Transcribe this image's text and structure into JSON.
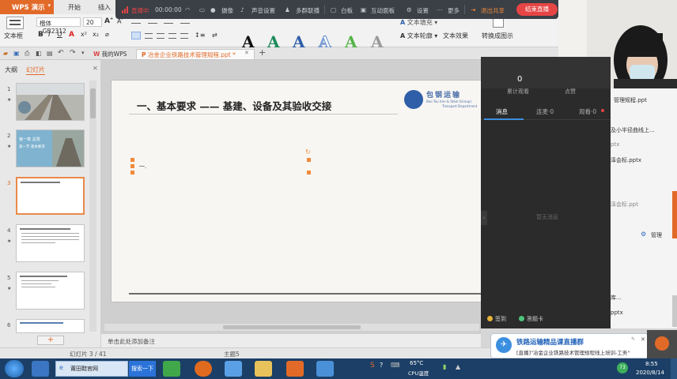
{
  "app": {
    "name": "WPS 演示",
    "menu": [
      "开始",
      "插入"
    ]
  },
  "ribbon": {
    "textbox_label": "文本框",
    "font_name": "楷体_GB2312",
    "font_size": "20",
    "wordart_letter": "A",
    "text_fill": "文本填充",
    "text_outline": "文本轮廓",
    "text_effect": "文本效果",
    "convert_label": "转换成图示"
  },
  "tabs": {
    "mywps": "我的WPS",
    "doc": "冶金企业铁路技术管理规程.ppt *"
  },
  "leftpanel": {
    "outline_tab": "大纲",
    "slides_tab": "幻灯片",
    "slide_numbers": [
      "1",
      "2",
      "3",
      "4",
      "5",
      "6"
    ],
    "thumb2_text": [
      "第一章 总则",
      "第一节 基本要求"
    ]
  },
  "slide": {
    "title": "一、基本要求 —— 基建、设备及其验收交接",
    "bullet": "一.",
    "logo_cn": "包钢运输",
    "logo_en": "Bao Tou Iron & Steel (Group)",
    "logo_en2": "Transport Department"
  },
  "notes_placeholder": "单击此处添加备注",
  "status": {
    "slide_index": "幻灯片 3 / 41",
    "theme": "主题5"
  },
  "livebar": {
    "live_label": "直播中",
    "timer": "00:00:00",
    "camera": "摄像",
    "sound": "声音设置",
    "multi": "多群联播",
    "whiteboard": "白板",
    "interactive": "互动面板",
    "settings": "设置",
    "more": "更多",
    "exit_share": "退出共享",
    "end_live": "结束直播"
  },
  "livepanel": {
    "viewers_count": "0",
    "viewers_label": "累计观看",
    "likes_label": "点赞",
    "tab_messages": "消息",
    "tab_linkmic": "连麦·0",
    "tab_watching": "观看·0",
    "empty_text": "暂无消息",
    "signin": "签到",
    "card": "答题卡"
  },
  "rightpane": {
    "files": [
      "管理规程.ppt",
      "及小半径曲线上...",
      "ptx",
      "泽会标.pptx",
      "泽会标.ppt",
      "管理",
      "库...",
      "pptx"
    ]
  },
  "notification": {
    "title": "铁路运输精品课直播群",
    "body": "[直播]\"冶金企业铁路技术管理规程线上培训-工务\""
  },
  "taskbar": {
    "browser_tab": "莆田鞋官网",
    "search_btn": "搜索一下",
    "temp": "65°C",
    "cpu_label": "CPU温度",
    "time": "8:55",
    "date": "2020/8/14",
    "badge": "73"
  },
  "colors": {
    "accent": "#e26a28",
    "live_red": "#e64545",
    "taskbar": "#1b3f66"
  }
}
